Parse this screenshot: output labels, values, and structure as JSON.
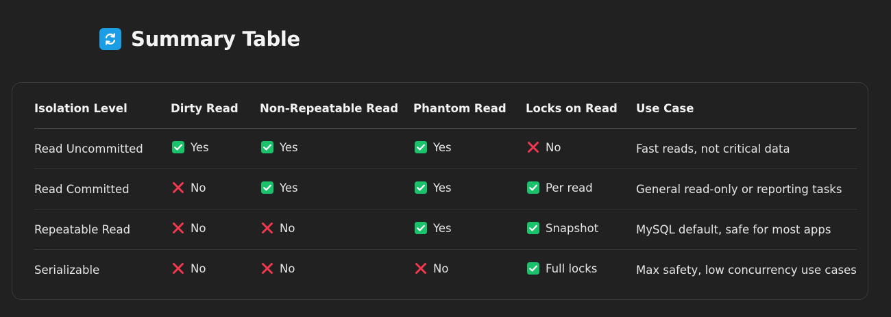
{
  "heading": {
    "title": "Summary Table",
    "icon": "refresh-arrows-icon",
    "icon_color": "#1b9ee6"
  },
  "colors": {
    "yes": "#19c26b",
    "no": "#f0384f"
  },
  "table": {
    "headers": [
      "Isolation Level",
      "Dirty Read",
      "Non-Repeatable Read",
      "Phantom Read",
      "Locks on Read",
      "Use Case"
    ],
    "rows": [
      {
        "level": "Read Uncommitted",
        "dirty": {
          "status": "yes",
          "text": "Yes"
        },
        "nonrepeatable": {
          "status": "yes",
          "text": "Yes"
        },
        "phantom": {
          "status": "yes",
          "text": "Yes"
        },
        "locks": {
          "status": "no",
          "text": "No"
        },
        "use_case": "Fast reads, not critical data"
      },
      {
        "level": "Read Committed",
        "dirty": {
          "status": "no",
          "text": "No"
        },
        "nonrepeatable": {
          "status": "yes",
          "text": "Yes"
        },
        "phantom": {
          "status": "yes",
          "text": "Yes"
        },
        "locks": {
          "status": "yes",
          "text": "Per read"
        },
        "use_case": "General read-only or reporting tasks"
      },
      {
        "level": "Repeatable Read",
        "dirty": {
          "status": "no",
          "text": "No"
        },
        "nonrepeatable": {
          "status": "no",
          "text": "No"
        },
        "phantom": {
          "status": "yes",
          "text": "Yes"
        },
        "locks": {
          "status": "yes",
          "text": "Snapshot"
        },
        "use_case": "MySQL default, safe for most apps"
      },
      {
        "level": "Serializable",
        "dirty": {
          "status": "no",
          "text": "No"
        },
        "nonrepeatable": {
          "status": "no",
          "text": "No"
        },
        "phantom": {
          "status": "no",
          "text": "No"
        },
        "locks": {
          "status": "yes",
          "text": "Full locks"
        },
        "use_case": "Max safety, low concurrency use cases"
      }
    ]
  }
}
